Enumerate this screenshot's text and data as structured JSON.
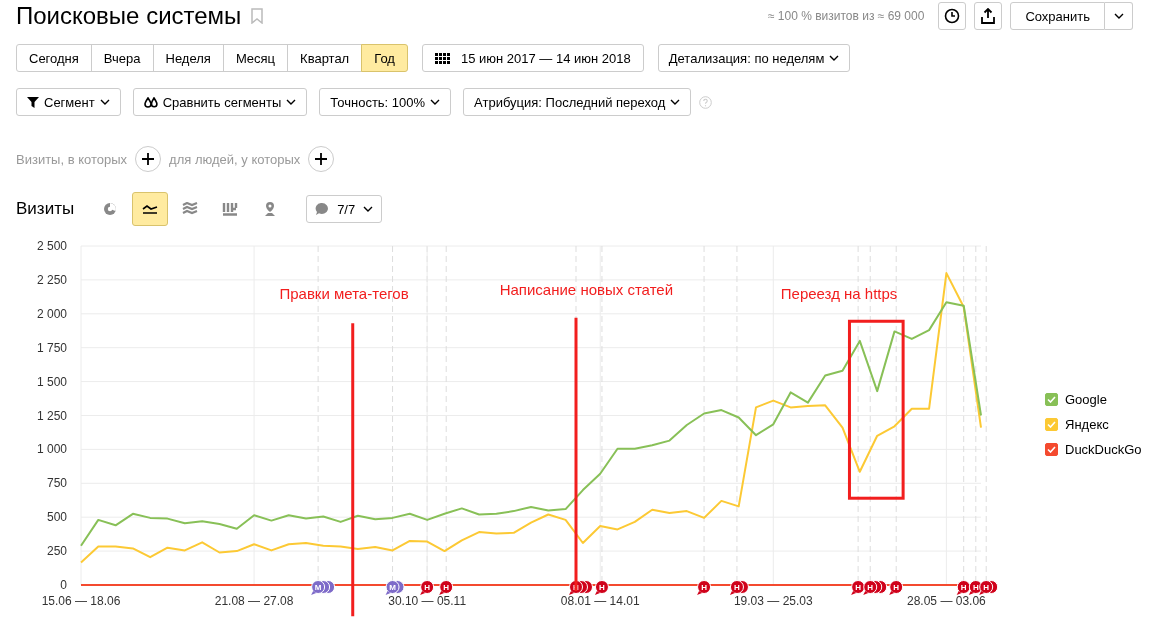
{
  "header": {
    "title": "Поисковые системы",
    "sample_note": "≈ 100 % визитов из ≈ 69 000",
    "save_button": "Сохранить"
  },
  "periods": [
    {
      "label": "Сегодня",
      "selected": false
    },
    {
      "label": "Вчера",
      "selected": false
    },
    {
      "label": "Неделя",
      "selected": false
    },
    {
      "label": "Месяц",
      "selected": false
    },
    {
      "label": "Квартал",
      "selected": false
    },
    {
      "label": "Год",
      "selected": true
    }
  ],
  "date_range": "15 июн 2017 — 14 июн 2018",
  "detail_dropdown": "Детализация: по неделям",
  "filters": [
    {
      "kind": "segment",
      "label": "Сегмент"
    },
    {
      "kind": "compare",
      "label": "Сравнить сегменты"
    },
    {
      "kind": "plain",
      "label": "Точность: 100%"
    },
    {
      "kind": "plain",
      "label": "Атрибуция: Последний переход"
    }
  ],
  "condition": {
    "visits_label": "Визиты, в которых",
    "people_label": "для людей, у которых"
  },
  "chart_section": {
    "title": "Визиты",
    "views": [
      {
        "kind": "pie",
        "selected": false
      },
      {
        "kind": "line",
        "selected": true
      },
      {
        "kind": "area",
        "selected": false
      },
      {
        "kind": "bars",
        "selected": false
      },
      {
        "kind": "map",
        "selected": false
      }
    ],
    "notes_dropdown": "7/7",
    "chart_data": {
      "type": "line",
      "ylim": [
        0,
        2500
      ],
      "grid": true,
      "categories": [
        "15.06 — 18.06",
        null,
        null,
        null,
        null,
        null,
        null,
        null,
        null,
        null,
        "21.08 — 27.08",
        null,
        null,
        null,
        null,
        null,
        null,
        null,
        null,
        null,
        "30.10 — 05.11",
        null,
        null,
        null,
        null,
        null,
        null,
        null,
        null,
        null,
        "08.01 — 14.01",
        null,
        null,
        null,
        null,
        null,
        null,
        null,
        null,
        null,
        "19.03 — 25.03",
        null,
        null,
        null,
        null,
        null,
        null,
        null,
        null,
        null,
        "28.05 — 03.06",
        null,
        null
      ],
      "yticks": [
        {
          "value": 0,
          "label": "0"
        },
        {
          "value": 250,
          "label": "250"
        },
        {
          "value": 500,
          "label": "500"
        },
        {
          "value": 750,
          "label": "750"
        },
        {
          "value": 1000,
          "label": "1 000"
        },
        {
          "value": 1250,
          "label": "1 250"
        },
        {
          "value": 1500,
          "label": "1 500"
        },
        {
          "value": 1750,
          "label": "1 750"
        },
        {
          "value": 2000,
          "label": "2 000"
        },
        {
          "value": 2250,
          "label": "2 250"
        },
        {
          "value": 2500,
          "label": "2 500"
        }
      ],
      "series": [
        {
          "name": "Google",
          "color": "#88c057",
          "values": [
            290,
            480,
            440,
            525,
            495,
            490,
            455,
            470,
            450,
            415,
            515,
            475,
            515,
            490,
            505,
            465,
            510,
            485,
            495,
            525,
            480,
            525,
            565,
            520,
            525,
            545,
            575,
            550,
            560,
            700,
            820,
            1005,
            1005,
            1030,
            1065,
            1180,
            1265,
            1290,
            1235,
            1105,
            1185,
            1420,
            1345,
            1545,
            1580,
            1800,
            1430,
            1870,
            1815,
            1880,
            2085,
            2060,
            1250
          ]
        },
        {
          "name": "Яндекс",
          "color": "#fcc934",
          "values": [
            165,
            285,
            285,
            270,
            205,
            275,
            255,
            315,
            240,
            250,
            300,
            255,
            300,
            310,
            290,
            285,
            265,
            280,
            255,
            325,
            320,
            250,
            330,
            390,
            380,
            385,
            460,
            520,
            480,
            310,
            435,
            410,
            465,
            555,
            530,
            545,
            495,
            620,
            580,
            1310,
            1360,
            1310,
            1320,
            1325,
            1160,
            835,
            1100,
            1170,
            1300,
            1300,
            2300,
            2050,
            1160
          ]
        },
        {
          "name": "DuckDuckGo",
          "color": "#f44a2f",
          "values": [
            0,
            0,
            0,
            0,
            0,
            0,
            0,
            0,
            0,
            0,
            0,
            0,
            0,
            0,
            0,
            0,
            0,
            0,
            0,
            0,
            0,
            0,
            0,
            0,
            0,
            0,
            0,
            0,
            0,
            0,
            0,
            0,
            0,
            0,
            0,
            0,
            0,
            0,
            0,
            0,
            0,
            0,
            0,
            0,
            0,
            0,
            0,
            0,
            0,
            0,
            0,
            0,
            0
          ]
        }
      ],
      "annotations": [
        {
          "text": "Правки мета-тегов"
        },
        {
          "text": "Написание новых статей"
        },
        {
          "text": "Переезд на https"
        }
      ]
    },
    "markers": [
      {
        "label": "M",
        "color": "#7e6bc9"
      },
      {
        "label": "M",
        "color": "#7e6bc9"
      },
      {
        "label": "H",
        "color": "#d0021b"
      },
      {
        "label": "H",
        "color": "#d0021b"
      },
      {
        "label": "H",
        "color": "#d0021b"
      },
      {
        "label": "H",
        "color": "#d0021b"
      },
      {
        "label": "H",
        "color": "#d0021b"
      },
      {
        "label": "H",
        "color": "#d0021b"
      },
      {
        "label": "H",
        "color": "#d0021b"
      },
      {
        "label": "H",
        "color": "#d0021b"
      },
      {
        "label": "H",
        "color": "#d0021b"
      },
      {
        "label": "H",
        "color": "#d0021b"
      },
      {
        "label": "H",
        "color": "#d0021b"
      },
      {
        "label": "H",
        "color": "#d0021b"
      }
    ],
    "legend": [
      {
        "checked": true
      },
      {
        "checked": true
      },
      {
        "checked": true
      }
    ]
  }
}
